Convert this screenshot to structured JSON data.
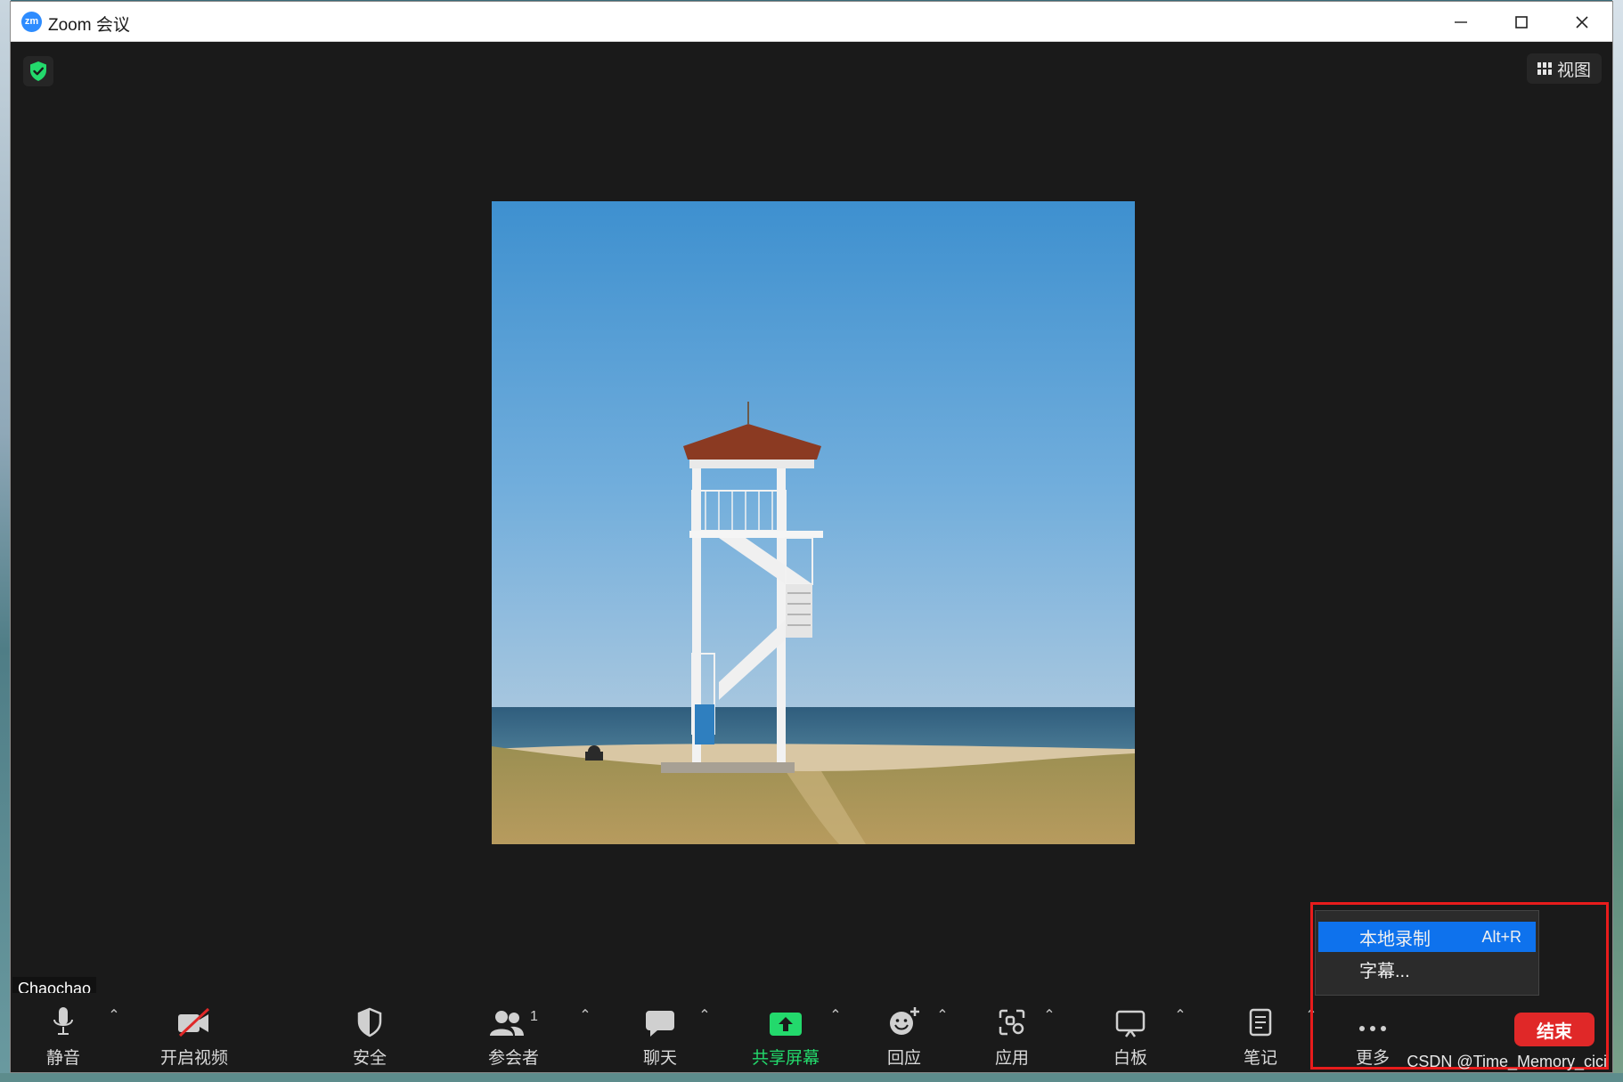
{
  "window": {
    "app_icon_text": "zm",
    "title": "Zoom 会议",
    "minimize_icon": "minimize-icon",
    "maximize_icon": "maximize-icon",
    "close_icon": "close-icon"
  },
  "top_bar": {
    "security_icon": "shield-check-icon",
    "view_label": "视图"
  },
  "participant": {
    "name": "Chaochao"
  },
  "toolbar": {
    "mute_label": "静音",
    "video_label": "开启视频",
    "security_label": "安全",
    "participants_label": "参会者",
    "participants_count": "1",
    "chat_label": "聊天",
    "share_label": "共享屏幕",
    "reactions_label": "回应",
    "apps_label": "应用",
    "whiteboard_label": "白板",
    "notes_label": "笔记",
    "more_label": "更多",
    "end_label": "结束",
    "caret": "⌃"
  },
  "more_menu": {
    "items": [
      {
        "label": "本地录制",
        "shortcut": "Alt+R",
        "active": true
      },
      {
        "label": "字幕...",
        "shortcut": "",
        "active": false
      }
    ]
  },
  "watermark": "CSDN @Time_Memory_cici",
  "colors": {
    "accent_blue": "#0e72ed",
    "share_green": "#23d96c",
    "end_red": "#e02828",
    "highlight_red": "#e81c1c"
  }
}
